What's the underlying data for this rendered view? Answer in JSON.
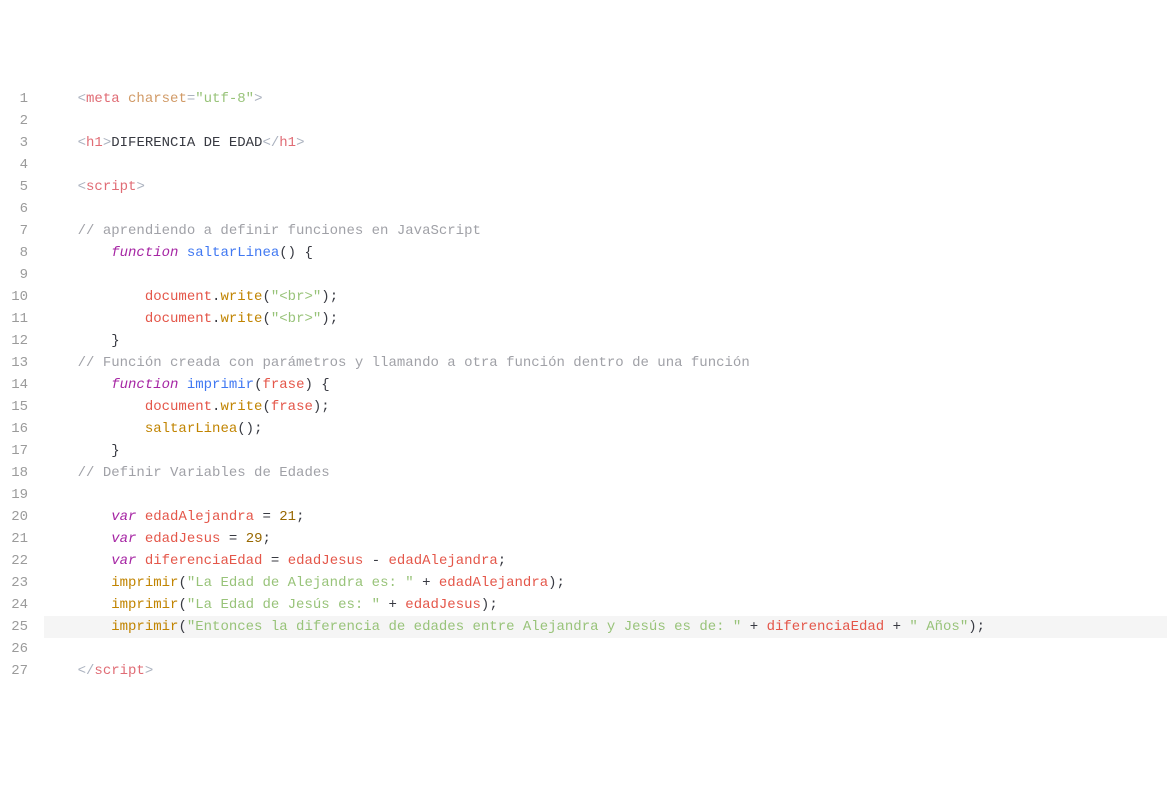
{
  "editor": {
    "line_count": 27,
    "highlighted_line": 25,
    "lines": [
      {
        "n": 1,
        "indent": "    ",
        "tokens": [
          {
            "c": "tok-punct",
            "t": "<"
          },
          {
            "c": "tok-tag",
            "t": "meta"
          },
          {
            "c": "tok-txt",
            "t": " "
          },
          {
            "c": "tok-attr",
            "t": "charset"
          },
          {
            "c": "tok-punct",
            "t": "="
          },
          {
            "c": "tok-str",
            "t": "\"utf-8\""
          },
          {
            "c": "tok-punct",
            "t": ">"
          }
        ]
      },
      {
        "n": 2,
        "indent": "",
        "tokens": []
      },
      {
        "n": 3,
        "indent": "    ",
        "tokens": [
          {
            "c": "tok-punct",
            "t": "<"
          },
          {
            "c": "tok-tag",
            "t": "h1"
          },
          {
            "c": "tok-punct",
            "t": ">"
          },
          {
            "c": "tok-txt",
            "t": "DIFERENCIA DE EDAD"
          },
          {
            "c": "tok-punct",
            "t": "</"
          },
          {
            "c": "tok-tag",
            "t": "h1"
          },
          {
            "c": "tok-punct",
            "t": ">"
          }
        ]
      },
      {
        "n": 4,
        "indent": "",
        "tokens": []
      },
      {
        "n": 5,
        "indent": "    ",
        "tokens": [
          {
            "c": "tok-punct",
            "t": "<"
          },
          {
            "c": "tok-tag",
            "t": "script"
          },
          {
            "c": "tok-punct",
            "t": ">"
          }
        ]
      },
      {
        "n": 6,
        "indent": "",
        "tokens": []
      },
      {
        "n": 7,
        "indent": "    ",
        "tokens": [
          {
            "c": "tok-comment",
            "t": "// aprendiendo a definir funciones en JavaScript"
          }
        ]
      },
      {
        "n": 8,
        "indent": "        ",
        "tokens": [
          {
            "c": "tok-kw",
            "t": "function"
          },
          {
            "c": "tok-txt",
            "t": " "
          },
          {
            "c": "tok-fn",
            "t": "saltarLinea"
          },
          {
            "c": "tok-brace",
            "t": "()"
          },
          {
            "c": "tok-txt",
            "t": " "
          },
          {
            "c": "tok-brace",
            "t": "{"
          }
        ]
      },
      {
        "n": 9,
        "indent": "",
        "tokens": []
      },
      {
        "n": 10,
        "indent": "            ",
        "tokens": [
          {
            "c": "tok-var",
            "t": "document"
          },
          {
            "c": "tok-dot",
            "t": "."
          },
          {
            "c": "tok-call",
            "t": "write"
          },
          {
            "c": "tok-brace",
            "t": "("
          },
          {
            "c": "tok-str",
            "t": "\"<br>\""
          },
          {
            "c": "tok-brace",
            "t": ")"
          },
          {
            "c": "tok-txt",
            "t": ";"
          }
        ]
      },
      {
        "n": 11,
        "indent": "            ",
        "tokens": [
          {
            "c": "tok-var",
            "t": "document"
          },
          {
            "c": "tok-dot",
            "t": "."
          },
          {
            "c": "tok-call",
            "t": "write"
          },
          {
            "c": "tok-brace",
            "t": "("
          },
          {
            "c": "tok-str",
            "t": "\"<br>\""
          },
          {
            "c": "tok-brace",
            "t": ")"
          },
          {
            "c": "tok-txt",
            "t": ";"
          }
        ]
      },
      {
        "n": 12,
        "indent": "        ",
        "tokens": [
          {
            "c": "tok-brace",
            "t": "}"
          }
        ]
      },
      {
        "n": 13,
        "indent": "    ",
        "tokens": [
          {
            "c": "tok-comment",
            "t": "// Función creada con parámetros y llamando a otra función dentro de una función"
          }
        ]
      },
      {
        "n": 14,
        "indent": "        ",
        "tokens": [
          {
            "c": "tok-kw",
            "t": "function"
          },
          {
            "c": "tok-txt",
            "t": " "
          },
          {
            "c": "tok-fn",
            "t": "imprimir"
          },
          {
            "c": "tok-brace",
            "t": "("
          },
          {
            "c": "tok-var",
            "t": "frase"
          },
          {
            "c": "tok-brace",
            "t": ")"
          },
          {
            "c": "tok-txt",
            "t": " "
          },
          {
            "c": "tok-brace",
            "t": "{"
          }
        ]
      },
      {
        "n": 15,
        "indent": "            ",
        "tokens": [
          {
            "c": "tok-var",
            "t": "document"
          },
          {
            "c": "tok-dot",
            "t": "."
          },
          {
            "c": "tok-call",
            "t": "write"
          },
          {
            "c": "tok-brace",
            "t": "("
          },
          {
            "c": "tok-var",
            "t": "frase"
          },
          {
            "c": "tok-brace",
            "t": ")"
          },
          {
            "c": "tok-txt",
            "t": ";"
          }
        ]
      },
      {
        "n": 16,
        "indent": "            ",
        "tokens": [
          {
            "c": "tok-call",
            "t": "saltarLinea"
          },
          {
            "c": "tok-brace",
            "t": "()"
          },
          {
            "c": "tok-txt",
            "t": ";"
          }
        ]
      },
      {
        "n": 17,
        "indent": "        ",
        "tokens": [
          {
            "c": "tok-brace",
            "t": "}"
          }
        ]
      },
      {
        "n": 18,
        "indent": "    ",
        "tokens": [
          {
            "c": "tok-comment",
            "t": "// Definir Variables de Edades"
          }
        ]
      },
      {
        "n": 19,
        "indent": "",
        "tokens": []
      },
      {
        "n": 20,
        "indent": "        ",
        "tokens": [
          {
            "c": "tok-kw",
            "t": "var"
          },
          {
            "c": "tok-txt",
            "t": " "
          },
          {
            "c": "tok-var",
            "t": "edadAlejandra"
          },
          {
            "c": "tok-txt",
            "t": " "
          },
          {
            "c": "tok-op",
            "t": "="
          },
          {
            "c": "tok-txt",
            "t": " "
          },
          {
            "c": "tok-num",
            "t": "21"
          },
          {
            "c": "tok-txt",
            "t": ";"
          }
        ]
      },
      {
        "n": 21,
        "indent": "        ",
        "tokens": [
          {
            "c": "tok-kw",
            "t": "var"
          },
          {
            "c": "tok-txt",
            "t": " "
          },
          {
            "c": "tok-var",
            "t": "edadJesus"
          },
          {
            "c": "tok-txt",
            "t": " "
          },
          {
            "c": "tok-op",
            "t": "="
          },
          {
            "c": "tok-txt",
            "t": " "
          },
          {
            "c": "tok-num",
            "t": "29"
          },
          {
            "c": "tok-txt",
            "t": ";"
          }
        ]
      },
      {
        "n": 22,
        "indent": "        ",
        "tokens": [
          {
            "c": "tok-kw",
            "t": "var"
          },
          {
            "c": "tok-txt",
            "t": " "
          },
          {
            "c": "tok-var",
            "t": "diferenciaEdad"
          },
          {
            "c": "tok-txt",
            "t": " "
          },
          {
            "c": "tok-op",
            "t": "="
          },
          {
            "c": "tok-txt",
            "t": " "
          },
          {
            "c": "tok-var",
            "t": "edadJesus"
          },
          {
            "c": "tok-txt",
            "t": " "
          },
          {
            "c": "tok-op",
            "t": "-"
          },
          {
            "c": "tok-txt",
            "t": " "
          },
          {
            "c": "tok-var",
            "t": "edadAlejandra"
          },
          {
            "c": "tok-txt",
            "t": ";"
          }
        ]
      },
      {
        "n": 23,
        "indent": "        ",
        "tokens": [
          {
            "c": "tok-call",
            "t": "imprimir"
          },
          {
            "c": "tok-brace",
            "t": "("
          },
          {
            "c": "tok-str",
            "t": "\"La Edad de Alejandra es: \""
          },
          {
            "c": "tok-txt",
            "t": " "
          },
          {
            "c": "tok-op",
            "t": "+"
          },
          {
            "c": "tok-txt",
            "t": " "
          },
          {
            "c": "tok-var",
            "t": "edadAlejandra"
          },
          {
            "c": "tok-brace",
            "t": ")"
          },
          {
            "c": "tok-txt",
            "t": ";"
          }
        ]
      },
      {
        "n": 24,
        "indent": "        ",
        "tokens": [
          {
            "c": "tok-call",
            "t": "imprimir"
          },
          {
            "c": "tok-brace",
            "t": "("
          },
          {
            "c": "tok-str",
            "t": "\"La Edad de Jesús es: \""
          },
          {
            "c": "tok-txt",
            "t": " "
          },
          {
            "c": "tok-op",
            "t": "+"
          },
          {
            "c": "tok-txt",
            "t": " "
          },
          {
            "c": "tok-var",
            "t": "edadJesus"
          },
          {
            "c": "tok-brace",
            "t": ")"
          },
          {
            "c": "tok-txt",
            "t": ";"
          }
        ]
      },
      {
        "n": 25,
        "indent": "        ",
        "tokens": [
          {
            "c": "tok-call",
            "t": "imprimir"
          },
          {
            "c": "tok-brace",
            "t": "("
          },
          {
            "c": "tok-str",
            "t": "\"Entonces la diferencia de edades entre Alejandra y Jesús es de: \""
          },
          {
            "c": "tok-txt",
            "t": " "
          },
          {
            "c": "tok-op",
            "t": "+"
          },
          {
            "c": "tok-txt",
            "t": " "
          },
          {
            "c": "tok-var",
            "t": "diferenciaEdad"
          },
          {
            "c": "tok-txt",
            "t": " "
          },
          {
            "c": "tok-op",
            "t": "+"
          },
          {
            "c": "tok-txt",
            "t": " "
          },
          {
            "c": "tok-str",
            "t": "\" Años\""
          },
          {
            "c": "tok-brace",
            "t": ")"
          },
          {
            "c": "tok-txt",
            "t": ";"
          }
        ]
      },
      {
        "n": 26,
        "indent": "",
        "tokens": []
      },
      {
        "n": 27,
        "indent": "    ",
        "tokens": [
          {
            "c": "tok-punct",
            "t": "</"
          },
          {
            "c": "tok-tag",
            "t": "script"
          },
          {
            "c": "tok-punct",
            "t": ">"
          }
        ]
      }
    ]
  }
}
